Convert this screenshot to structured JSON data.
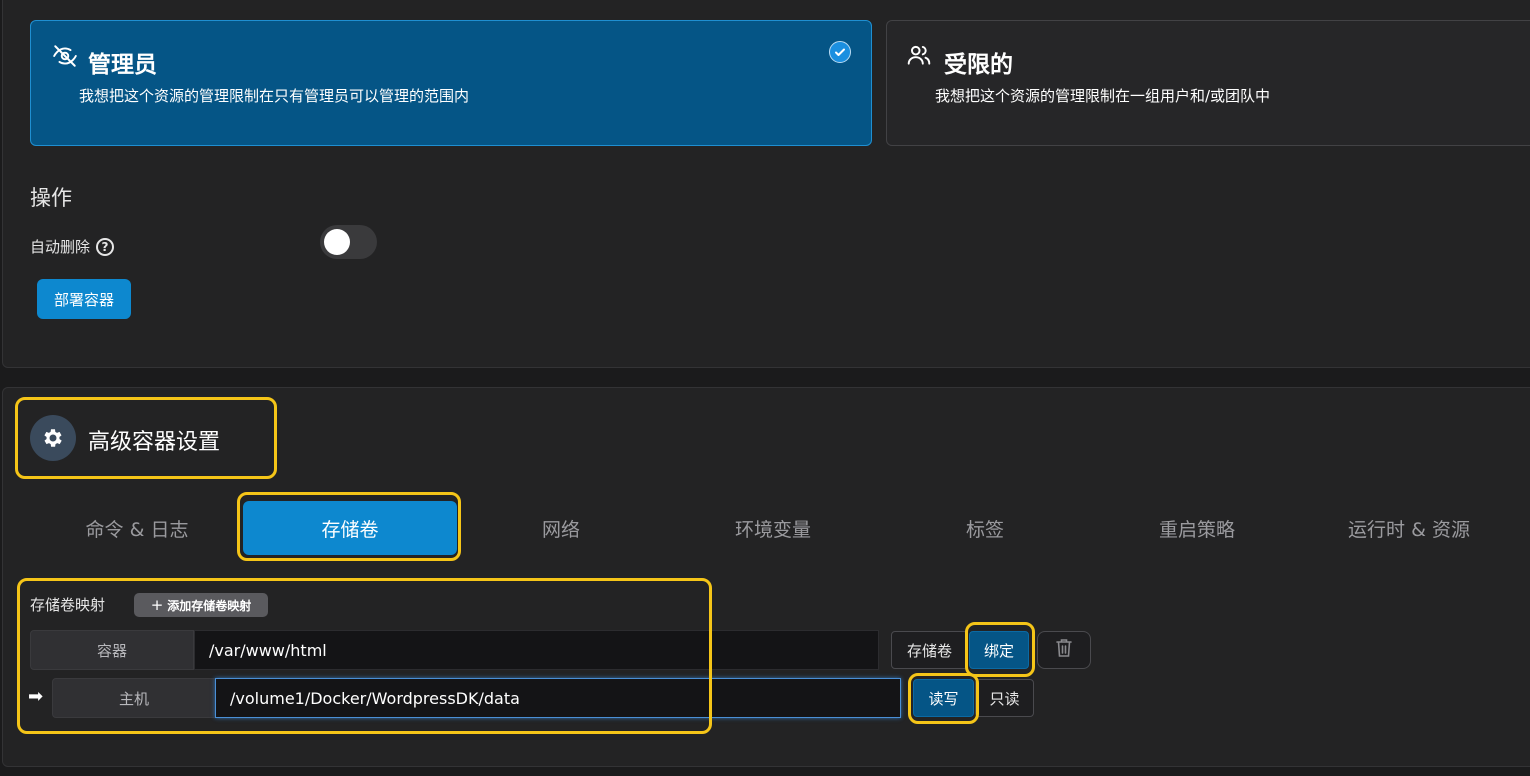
{
  "access": {
    "admin": {
      "title": "管理员",
      "description": "我想把这个资源的管理限制在只有管理员可以管理的范围内",
      "selected": true,
      "icon": "eye-slash-icon"
    },
    "restricted": {
      "title": "受限的",
      "description": "我想把这个资源的管理限制在一组用户和/或团队中",
      "selected": false,
      "icon": "users-icon"
    }
  },
  "actions": {
    "heading": "操作",
    "auto_delete_label": "自动删除",
    "auto_delete_help": "?",
    "auto_delete_enabled": false,
    "deploy_button": "部署容器"
  },
  "advanced": {
    "title": "高级容器设置",
    "icon": "gear-icon",
    "tabs": [
      {
        "label": "命令 & 日志",
        "active": false
      },
      {
        "label": "存储卷",
        "active": true
      },
      {
        "label": "网络",
        "active": false
      },
      {
        "label": "环境变量",
        "active": false
      },
      {
        "label": "标签",
        "active": false
      },
      {
        "label": "重启策略",
        "active": false
      },
      {
        "label": "运行时 & 资源",
        "active": false
      }
    ]
  },
  "volumes": {
    "label": "存储卷映射",
    "add_button": "添加存储卷映射",
    "container_label": "容器",
    "container_path": "/var/www/html",
    "host_label": "主机",
    "host_path": "/volume1/Docker/WordpressDK/data",
    "type_volume": "存储卷",
    "type_bind": "绑定",
    "mode_rw": "读写",
    "mode_ro": "只读",
    "arrow": "➡"
  },
  "colors": {
    "accent": "#0d88cf",
    "selected_card": "#055586",
    "highlight": "#f5c518"
  }
}
